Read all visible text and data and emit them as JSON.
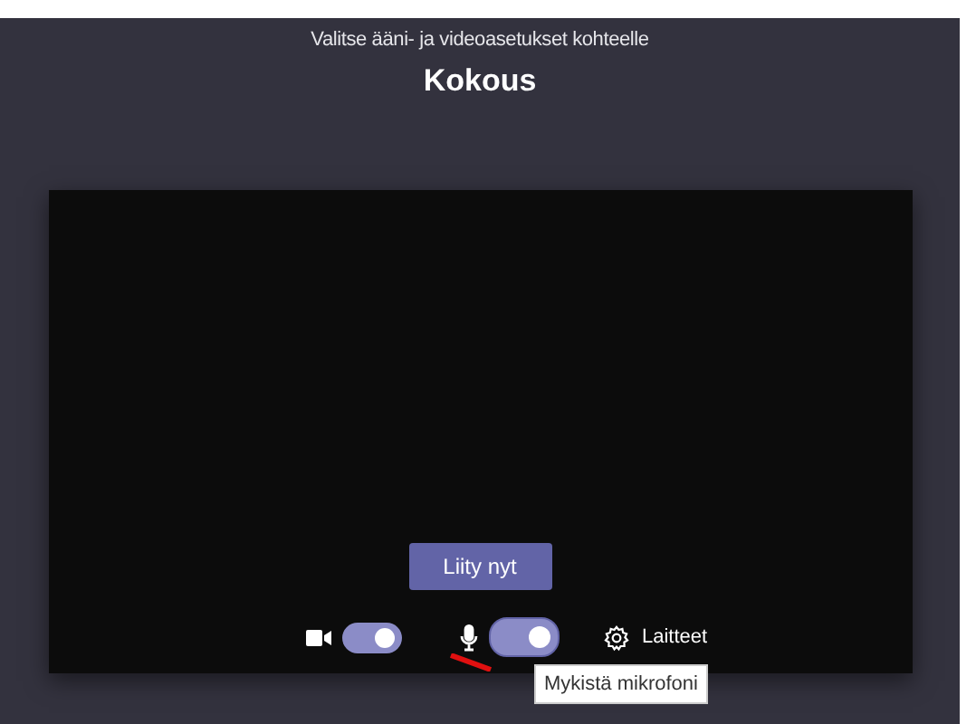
{
  "subtitle": "Valitse ääni- ja videoasetukset kohteelle",
  "title": "Kokous",
  "join_button": "Liity nyt",
  "camera": {
    "on": true
  },
  "microphone": {
    "on": true
  },
  "devices_button": "Laitteet",
  "tooltip": "Mykistä mikrofoni"
}
